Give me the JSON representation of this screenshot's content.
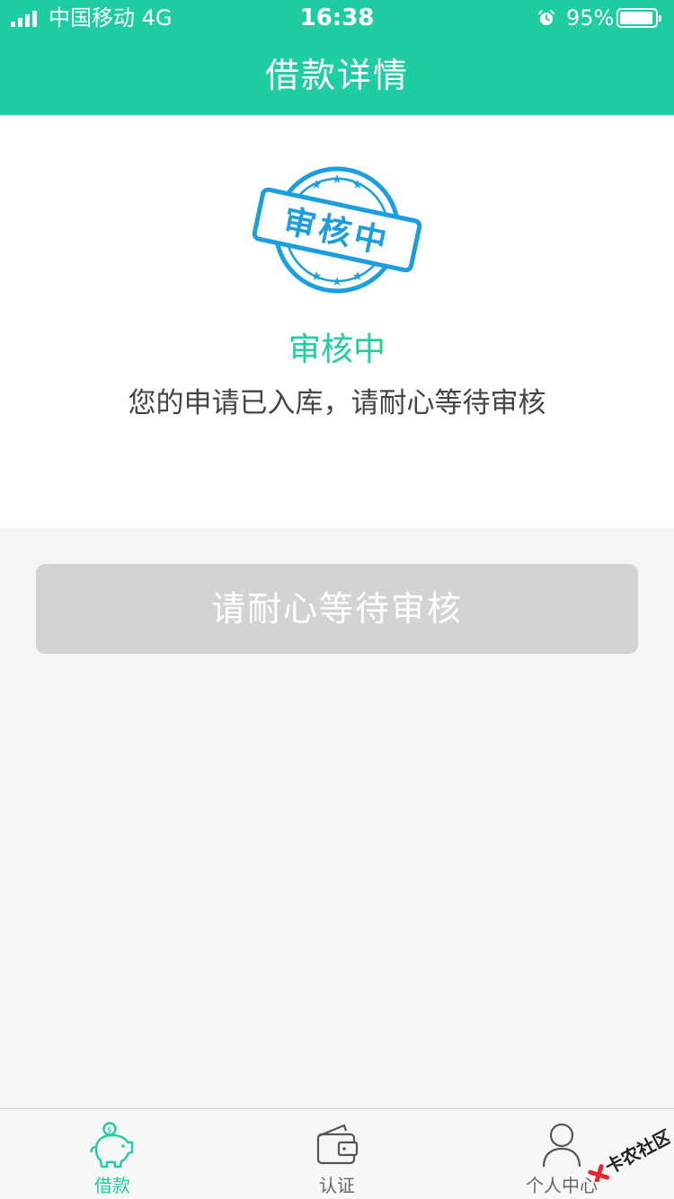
{
  "status_bar": {
    "carrier": "中国移动  4G",
    "time": "16:38",
    "battery_percent": "95%",
    "battery_level": 0.95,
    "alarm_icon": "alarm-clock-icon"
  },
  "nav": {
    "title": "借款详情"
  },
  "status_card": {
    "stamp_text": "审核中",
    "title": "审核中",
    "description": "您的申请已入库，请耐心等待审核"
  },
  "action": {
    "button_label": "请耐心等待审核"
  },
  "tab_bar": {
    "tabs": [
      {
        "label": "借款",
        "icon": "piggy-bank-icon",
        "active": true
      },
      {
        "label": "认证",
        "icon": "wallet-icon",
        "active": false
      },
      {
        "label": "个人中心",
        "icon": "user-icon",
        "active": false
      }
    ]
  },
  "watermark": {
    "text": "卡农社区"
  },
  "colors": {
    "brand": "#1ecda2",
    "stamp": "#1a9ee0",
    "button_disabled": "#d3d3d3",
    "background": "#f5f5f5"
  }
}
